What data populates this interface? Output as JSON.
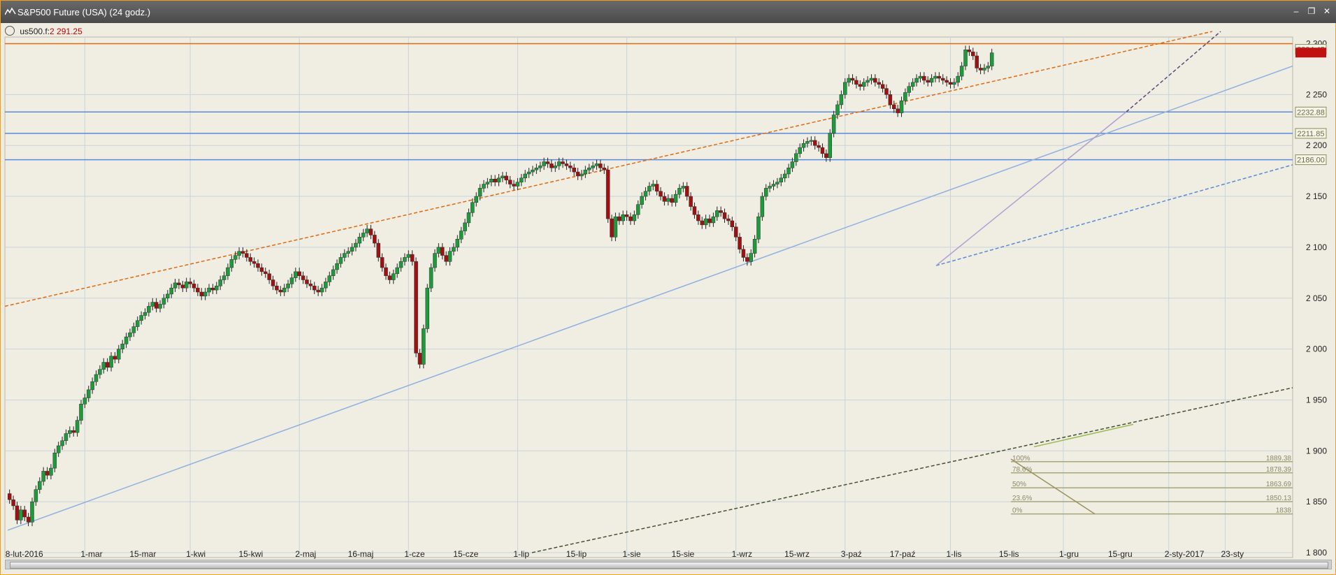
{
  "window": {
    "title": "S&P500 Future (USA) (24 godz.)"
  },
  "info": {
    "symbol": "us500.f:",
    "price": "2 291.25"
  },
  "colors": {
    "up": "#1e9a3c",
    "down": "#a01010",
    "wick": "#222222",
    "grid": "#c9d3dc",
    "hline": "#5a8ad6",
    "accent": "#e06a10"
  },
  "chart_data": {
    "type": "candlestick",
    "ylim": [
      1800,
      2300
    ],
    "yticks": [
      "1 800",
      "1 850",
      "1 900",
      "1 950",
      "2 000",
      "2 050",
      "2 100",
      "2 150",
      "2 200",
      "2 250",
      "2 300"
    ],
    "xlabels": [
      "8-lut-2016",
      "1-mar",
      "15-mar",
      "1-kwi",
      "15-kwi",
      "2-maj",
      "16-maj",
      "1-cze",
      "15-cze",
      "1-lip",
      "15-lip",
      "1-sie",
      "15-sie",
      "1-wrz",
      "15-wrz",
      "3-paź",
      "17-paź",
      "1-lis",
      "15-lis",
      "1-gru",
      "15-gru",
      "2-sty-2017",
      "23-sty"
    ],
    "xlabel_index": [
      0,
      20,
      33,
      48,
      62,
      77,
      91,
      106,
      119,
      135,
      149,
      164,
      177,
      193,
      207,
      222,
      235,
      250,
      264,
      280,
      293,
      308,
      323
    ],
    "vgrid_index": [
      20,
      48,
      77,
      106,
      135,
      164,
      193,
      222,
      250,
      280,
      308,
      323
    ],
    "total_bars": 334,
    "closes": [
      1852,
      1846,
      1832,
      1842,
      1835,
      1830,
      1850,
      1862,
      1870,
      1880,
      1876,
      1883,
      1898,
      1905,
      1910,
      1917,
      1920,
      1918,
      1930,
      1946,
      1952,
      1960,
      1968,
      1975,
      1980,
      1987,
      1982,
      1993,
      1990,
      2000,
      2005,
      2012,
      2016,
      2022,
      2028,
      2033,
      2036,
      2042,
      2046,
      2040,
      2044,
      2050,
      2054,
      2060,
      2065,
      2063,
      2060,
      2066,
      2064,
      2060,
      2056,
      2052,
      2056,
      2060,
      2058,
      2062,
      2068,
      2072,
      2080,
      2088,
      2092,
      2096,
      2094,
      2090,
      2086,
      2084,
      2080,
      2076,
      2074,
      2068,
      2062,
      2058,
      2056,
      2060,
      2064,
      2070,
      2076,
      2072,
      2068,
      2064,
      2062,
      2058,
      2056,
      2060,
      2066,
      2072,
      2078,
      2084,
      2090,
      2094,
      2096,
      2100,
      2104,
      2110,
      2114,
      2118,
      2112,
      2104,
      2090,
      2080,
      2072,
      2068,
      2074,
      2080,
      2086,
      2090,
      2093,
      2086,
      1996,
      1985,
      2020,
      2060,
      2080,
      2094,
      2100,
      2092,
      2086,
      2096,
      2100,
      2108,
      2116,
      2124,
      2134,
      2144,
      2150,
      2158,
      2162,
      2164,
      2167,
      2164,
      2168,
      2170,
      2166,
      2162,
      2160,
      2164,
      2168,
      2172,
      2174,
      2176,
      2178,
      2180,
      2184,
      2182,
      2178,
      2180,
      2184,
      2182,
      2180,
      2178,
      2174,
      2170,
      2172,
      2176,
      2178,
      2180,
      2182,
      2178,
      2176,
      2128,
      2110,
      2130,
      2126,
      2132,
      2130,
      2126,
      2132,
      2142,
      2150,
      2155,
      2160,
      2162,
      2155,
      2150,
      2145,
      2148,
      2144,
      2152,
      2158,
      2160,
      2150,
      2140,
      2132,
      2126,
      2122,
      2128,
      2124,
      2130,
      2136,
      2134,
      2128,
      2126,
      2120,
      2110,
      2098,
      2090,
      2086,
      2094,
      2108,
      2130,
      2150,
      2158,
      2160,
      2162,
      2164,
      2168,
      2172,
      2178,
      2184,
      2192,
      2198,
      2202,
      2204,
      2205,
      2200,
      2198,
      2192,
      2188,
      2212,
      2230,
      2240,
      2250,
      2262,
      2266,
      2264,
      2260,
      2258,
      2262,
      2264,
      2266,
      2262,
      2260,
      2256,
      2250,
      2240,
      2236,
      2232,
      2244,
      2252,
      2258,
      2262,
      2266,
      2268,
      2264,
      2262,
      2266,
      2268,
      2266,
      2264,
      2262,
      2260,
      2262,
      2268,
      2278,
      2294,
      2292,
      2288,
      2276,
      2274,
      2276,
      2278,
      2291
    ]
  },
  "price_tags": [
    "2294.45",
    "2232.88",
    "2211.85",
    "2186.00"
  ],
  "fib": {
    "levels": [
      "100%",
      "78.6%",
      "50%",
      "23.6%",
      "0%"
    ],
    "values": [
      "1889.38",
      "1878.39",
      "1863.69",
      "1850.13",
      "1838"
    ]
  }
}
